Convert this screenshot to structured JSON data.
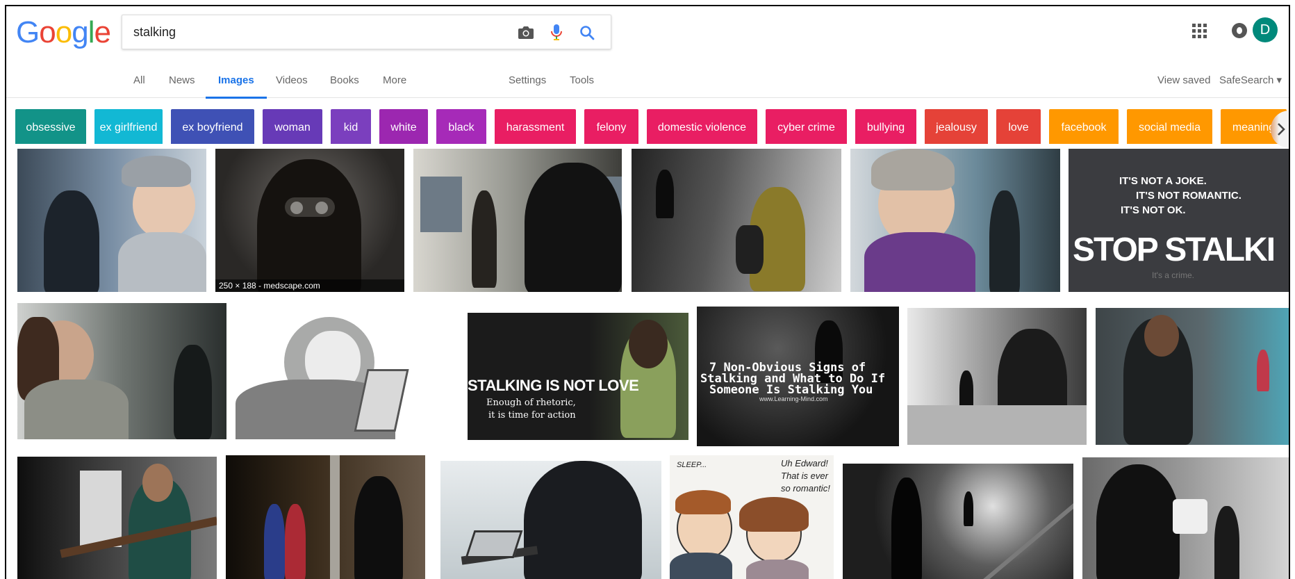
{
  "logo": {
    "letters": [
      "G",
      "o",
      "o",
      "g",
      "l",
      "e"
    ],
    "colors": [
      "#4285F4",
      "#EA4335",
      "#FBBC05",
      "#4285F4",
      "#34A853",
      "#EA4335"
    ]
  },
  "search": {
    "value": "stalking",
    "placeholder": ""
  },
  "account": {
    "initial": "D",
    "avatar_color": "#00897B"
  },
  "nav": {
    "tabs": [
      "All",
      "News",
      "Images",
      "Videos",
      "Books",
      "More"
    ],
    "active": "Images",
    "settings": "Settings",
    "tools": "Tools",
    "view_saved": "View saved",
    "safesearch": "SafeSearch ▾"
  },
  "chips": [
    {
      "label": "obsessive",
      "color": "#129388"
    },
    {
      "label": "ex girlfriend",
      "color": "#12B8D4"
    },
    {
      "label": "ex boyfriend",
      "color": "#3F51B5"
    },
    {
      "label": "woman",
      "color": "#673AB7"
    },
    {
      "label": "kid",
      "color": "#7B3FBE"
    },
    {
      "label": "white",
      "color": "#9C27B0"
    },
    {
      "label": "black",
      "color": "#A62AB8"
    },
    {
      "label": "harassment",
      "color": "#E91E63"
    },
    {
      "label": "felony",
      "color": "#E91E63"
    },
    {
      "label": "domestic violence",
      "color": "#E91E63"
    },
    {
      "label": "cyber crime",
      "color": "#E91E63"
    },
    {
      "label": "bullying",
      "color": "#E91E63"
    },
    {
      "label": "jealousy",
      "color": "#E54238"
    },
    {
      "label": "love",
      "color": "#E54238"
    },
    {
      "label": "facebook",
      "color": "#FF9800"
    },
    {
      "label": "social media",
      "color": "#FF9800"
    },
    {
      "label": "meaning",
      "color": "#FF9800"
    }
  ],
  "images": {
    "r1_2_caption": "250 × 188 - medscape.com",
    "r1_6_line1": "IT'S NOT A JOKE.",
    "r1_6_line2": "IT'S NOT ROMANTIC.",
    "r1_6_line3": "IT'S NOT OK.",
    "r1_6_big": "STOP STALKI",
    "r1_6_small": "It's a crime.",
    "r2_3_title": "STALKING IS NOT LOVE",
    "r2_3_sub1": "Enough of rhetoric,",
    "r2_3_sub2": "it is time for action",
    "r2_4_line1": "7 Non-Obvious Signs of",
    "r2_4_line2": "Stalking and What to Do If",
    "r2_4_line3": "Someone Is Stalking You",
    "r2_4_small": "www.Learning-Mind.com",
    "r3_4_text1": "Uh Edward!",
    "r3_4_text2": "That is ever",
    "r3_4_text3": "so romantic!",
    "r3_4_text4": "SLEEP..."
  }
}
